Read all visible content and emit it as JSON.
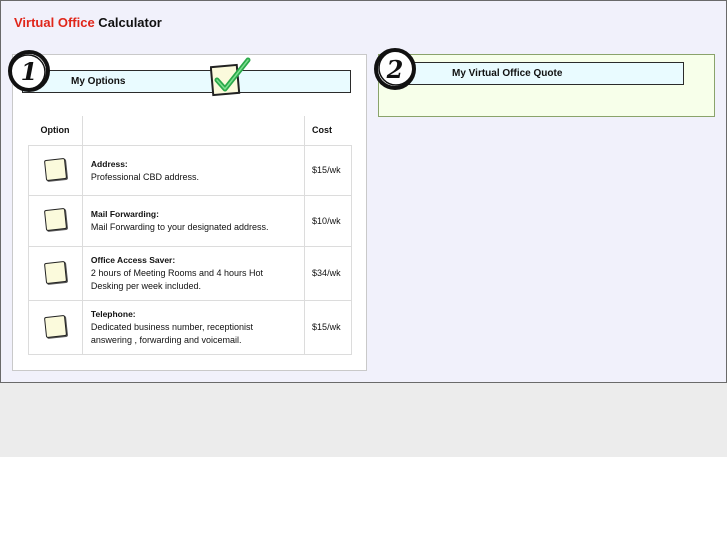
{
  "page": {
    "title_accent": "Virtual Office",
    "title_rest": " Calculator"
  },
  "options_panel": {
    "step_number": "1",
    "heading": "My Options",
    "columns": {
      "option": "Option",
      "description": "",
      "cost": "Cost"
    },
    "rows": [
      {
        "name": "Address:",
        "description": "Professional CBD address.",
        "cost": "$15/wk",
        "checked": false
      },
      {
        "name": "Mail Forwarding:",
        "description": "Mail Forwarding to your designated address.",
        "cost": "$10/wk",
        "checked": false
      },
      {
        "name": "Office Access Saver:",
        "description": "2 hours of Meeting Rooms and 4 hours Hot Desking per week included.",
        "cost": "$34/wk",
        "checked": false
      },
      {
        "name": "Telephone:",
        "description": "Dedicated business number, receptionist answering , forwarding and voicemail.",
        "cost": "$15/wk",
        "checked": false
      }
    ]
  },
  "quote_panel": {
    "step_number": "2",
    "heading": "My Virtual Office Quote"
  },
  "icons": {
    "step_badge": "circled-number-icon",
    "checkmark": "green-checkmark-icon",
    "checkbox": "checkbox-icon"
  },
  "colors": {
    "accent_red": "#e0261a",
    "frame_bg": "#f1f1fb",
    "header_bg": "#e9fbff",
    "quote_bg": "#f7ffea",
    "checkbox_fill": "#fbfadc",
    "check_green": "#2aa84a"
  }
}
